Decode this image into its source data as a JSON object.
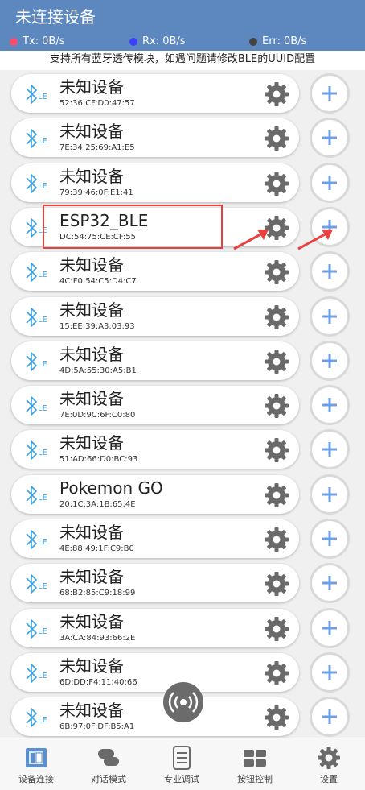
{
  "header": {
    "title": "未连接设备",
    "stats": [
      {
        "label": "Tx: 0B/s",
        "color": "#ff4d6d"
      },
      {
        "label": "Rx: 0B/s",
        "color": "#3d3dff"
      },
      {
        "label": "Err: 0B/s",
        "color": "#444444"
      }
    ]
  },
  "notice": "支持所有蓝牙透传模块，如遇问题请修改BLE的UUID配置",
  "devices": [
    {
      "name": "未知设备",
      "mac": "52:36:CF:D0:47:57"
    },
    {
      "name": "未知设备",
      "mac": "7E:34:25:69:A1:E5"
    },
    {
      "name": "未知设备",
      "mac": "79:39:46:0F:E1:41"
    },
    {
      "name": "ESP32_BLE",
      "mac": "DC:54:75:CE:CF:55"
    },
    {
      "name": "未知设备",
      "mac": "4C:F0:54:C5:D4:C7"
    },
    {
      "name": "未知设备",
      "mac": "15:EE:39:A3:03:93"
    },
    {
      "name": "未知设备",
      "mac": "4D:5A:55:30:A5:B1"
    },
    {
      "name": "未知设备",
      "mac": "7E:0D:9C:6F:C0:80"
    },
    {
      "name": "未知设备",
      "mac": "51:AD:66:D0:BC:93"
    },
    {
      "name": "Pokemon GO",
      "mac": "20:1C:3A:1B:65:4E"
    },
    {
      "name": "未知设备",
      "mac": "4E:88:49:1F:C9:B0"
    },
    {
      "name": "未知设备",
      "mac": "68:B2:85:C9:18:99"
    },
    {
      "name": "未知设备",
      "mac": "3A:CA:84:93:66:2E"
    },
    {
      "name": "未知设备",
      "mac": "6D:DD:F4:11:40:66"
    },
    {
      "name": "未知设备",
      "mac": "6B:97:0F:DF:B5:A1"
    }
  ],
  "tabs": [
    {
      "label": "设备连接",
      "icon": "device-connect-icon"
    },
    {
      "label": "对话模式",
      "icon": "chat-icon"
    },
    {
      "label": "专业调试",
      "icon": "debug-icon"
    },
    {
      "label": "按钮控制",
      "icon": "button-grid-icon"
    },
    {
      "label": "设置",
      "icon": "gear-icon"
    }
  ],
  "colors": {
    "header": "#5d88bf",
    "bluetooth": "#3b9fe0",
    "plus": "#6d9fe6",
    "highlight": "#e94040"
  }
}
